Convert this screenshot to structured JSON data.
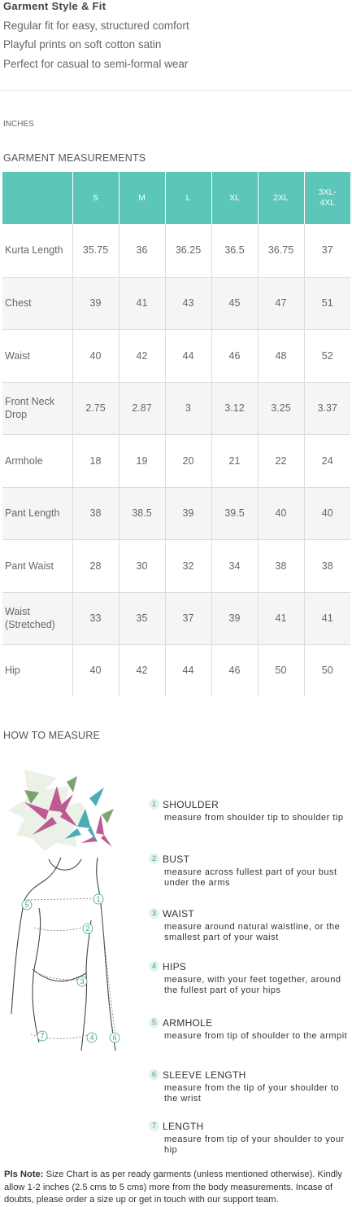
{
  "style": {
    "heading": "Garment Style & Fit",
    "features": [
      "Regular fit for easy, structured comfort",
      "Playful prints on soft cotton satin",
      "Perfect for casual to semi-formal wear"
    ]
  },
  "units_label": "INCHES",
  "measurements": {
    "heading": "GARMENT MEASUREMENTS",
    "sizes": [
      "S",
      "M",
      "L",
      "XL",
      "2XL",
      "3XL-4XL"
    ],
    "rows": [
      {
        "label": "Kurta Length",
        "values": [
          "35.75",
          "36",
          "36.25",
          "36.5",
          "36.75",
          "37"
        ]
      },
      {
        "label": "Chest",
        "values": [
          "39",
          "41",
          "43",
          "45",
          "47",
          "51"
        ]
      },
      {
        "label": "Waist",
        "values": [
          "40",
          "42",
          "44",
          "46",
          "48",
          "52"
        ]
      },
      {
        "label": "Front Neck Drop",
        "values": [
          "2.75",
          "2.87",
          "3",
          "3.12",
          "3.25",
          "3.37"
        ]
      },
      {
        "label": "Armhole",
        "values": [
          "18",
          "19",
          "20",
          "21",
          "22",
          "24"
        ]
      },
      {
        "label": "Pant Length",
        "values": [
          "38",
          "38.5",
          "39",
          "39.5",
          "40",
          "40"
        ]
      },
      {
        "label": "Pant Waist",
        "values": [
          "28",
          "30",
          "32",
          "34",
          "38",
          "38"
        ]
      },
      {
        "label": "Waist (Stretched)",
        "values": [
          "33",
          "35",
          "37",
          "39",
          "41",
          "41"
        ]
      },
      {
        "label": "Hip",
        "values": [
          "40",
          "42",
          "44",
          "46",
          "50",
          "50"
        ]
      }
    ]
  },
  "how_to": {
    "heading": "HOW TO MEASURE",
    "steps": [
      {
        "num": "1",
        "title": "SHOULDER",
        "desc": "measure from shoulder tip to shoulder tip"
      },
      {
        "num": "2",
        "title": "BUST",
        "desc": "measure across fullest part of your bust under the arms"
      },
      {
        "num": "3",
        "title": "WAIST",
        "desc": "measure around natural waistline, or the smallest part of your waist"
      },
      {
        "num": "4",
        "title": "HIPS",
        "desc": "measure, with your feet together, around the fullest part of your hips"
      },
      {
        "num": "5",
        "title": "ARMHOLE",
        "desc": "measure from tip of shoulder to the armpit"
      },
      {
        "num": "6",
        "title": "SLEEVE LENGTH",
        "desc": "measure from the tip of your shoulder to the wrist"
      },
      {
        "num": "7",
        "title": "LENGTH",
        "desc": "measure from tip of your shoulder to your hip"
      }
    ]
  },
  "note": {
    "lead": "Pls Note:",
    "text": "Size Chart is as per ready garments (unless mentioned otherwise). Kindly allow 1-2 inches (2.5 cms to 5 cms) more from the body measurements. Incase of doubts, please order a size up or get in touch with our support team."
  },
  "colors": {
    "accent": "#5cc6b9",
    "flower_pink": "#b84a8a",
    "flower_teal": "#3aa5ad",
    "leaf_green": "#5a8f4e"
  }
}
